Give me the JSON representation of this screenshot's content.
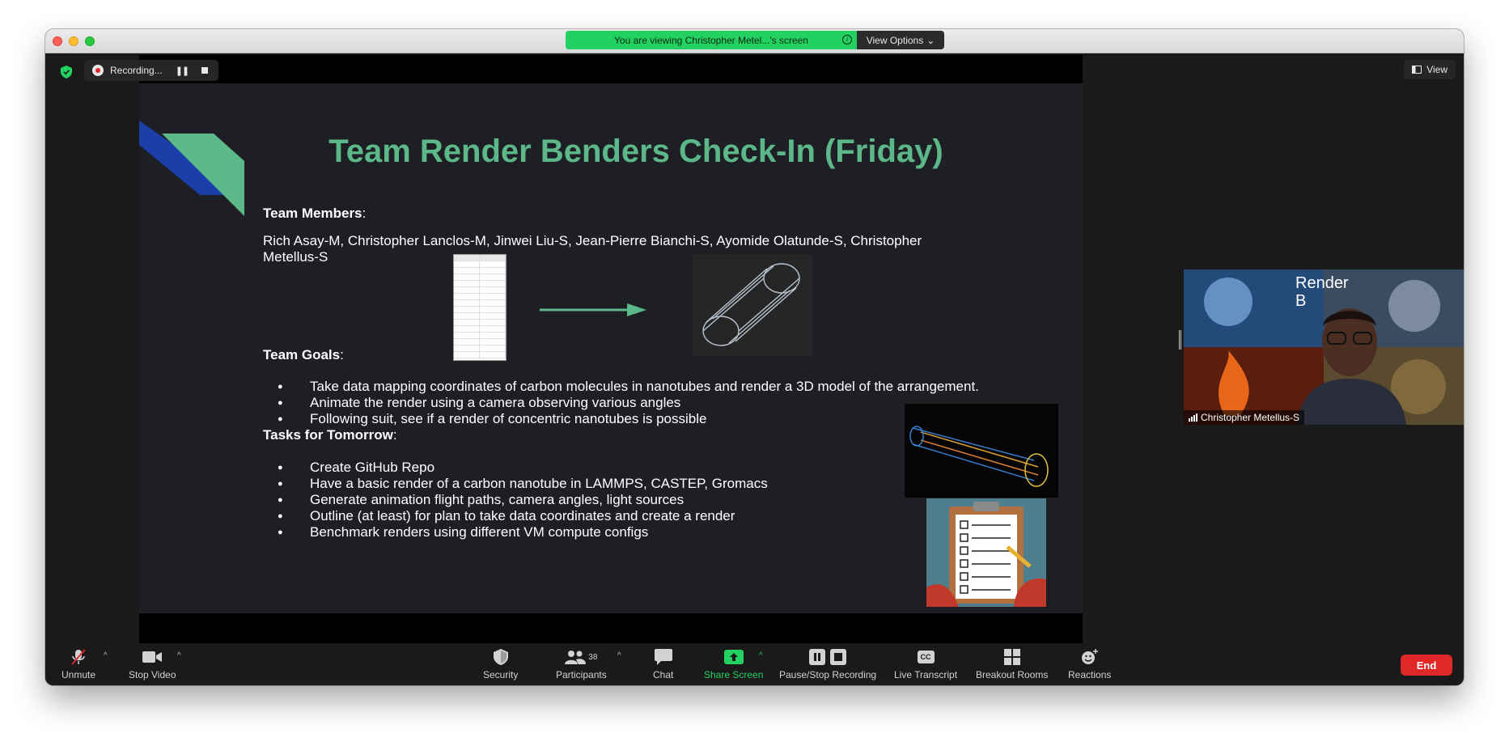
{
  "banner": {
    "viewing_text": "You are viewing Christopher Metel...'s screen",
    "view_options_label": "View Options"
  },
  "recording": {
    "label": "Recording..."
  },
  "view_button": {
    "label": "View"
  },
  "slide": {
    "title": "Team Render Benders Check-In (Friday)",
    "team_members_heading": "Team Members",
    "team_members_line1": "Rich Asay-M, Christopher Lanclos-M,  Jinwei Liu-S, Jean-Pierre Bianchi-S, Ayomide Olatunde-S, Christopher",
    "team_members_line2": "Metellus-S",
    "goals_heading": "Team Goals",
    "goals": [
      "Take  data mapping coordinates of carbon molecules in nanotubes and render a 3D model of the arrangement.",
      "Animate the render using a camera observing various angles",
      "Following suit, see if a render of concentric nanotubes is possible"
    ],
    "tasks_heading": "Tasks for Tomorrow",
    "tasks": [
      "Create GitHub Repo",
      "Have a basic render of a carbon nanotube in LAMMPS, CASTEP,  Gromacs",
      "Generate animation flight paths, camera angles, light sources",
      "Outline (at least) for plan to take data coordinates and create a render",
      "Benchmark renders using different VM compute configs"
    ],
    "accent_green": "#5cb889",
    "accent_blue": "#1a3fa8"
  },
  "participant": {
    "name": "Christopher Metellus-S",
    "overlay_text_line1": "Render",
    "overlay_text_line2": "B"
  },
  "toolbar": {
    "unmute_label": "Unmute",
    "stop_video_label": "Stop Video",
    "security_label": "Security",
    "participants_label": "Participants",
    "participants_count": "38",
    "chat_label": "Chat",
    "share_screen_label": "Share Screen",
    "pause_stop_recording_label": "Pause/Stop Recording",
    "live_transcript_label": "Live Transcript",
    "live_transcript_icon_text": "CC",
    "breakout_rooms_label": "Breakout Rooms",
    "reactions_label": "Reactions",
    "end_label": "End",
    "share_color": "#23d160",
    "end_color": "#e02828"
  }
}
